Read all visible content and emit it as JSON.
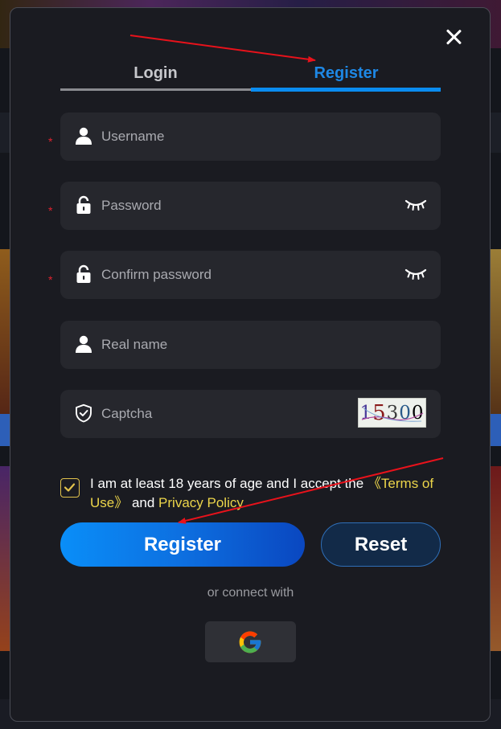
{
  "tabs": {
    "login": "Login",
    "register": "Register"
  },
  "form": {
    "username_placeholder": "Username",
    "password_placeholder": "Password",
    "confirm_password_placeholder": "Confirm password",
    "real_name_placeholder": "Real name",
    "captcha_placeholder": "Captcha",
    "required_mark": "*",
    "captcha_digits": [
      "1",
      "5",
      "3",
      "0",
      "0"
    ]
  },
  "agreement": {
    "checked": true,
    "text_before": "I am at least 18 years of age and I accept the ",
    "terms_link": "《Terms of Use》",
    "text_and": " and ",
    "privacy_link": "Privacy Policy"
  },
  "buttons": {
    "register": "Register",
    "reset": "Reset"
  },
  "social": {
    "connect_text": "or connect with",
    "google_icon": "google-icon"
  },
  "colors": {
    "accent_blue": "#1e88e5",
    "link_yellow": "#ecd54a",
    "required_red": "#e0222f",
    "modal_bg": "#1a1b21",
    "field_bg": "#26272d"
  }
}
